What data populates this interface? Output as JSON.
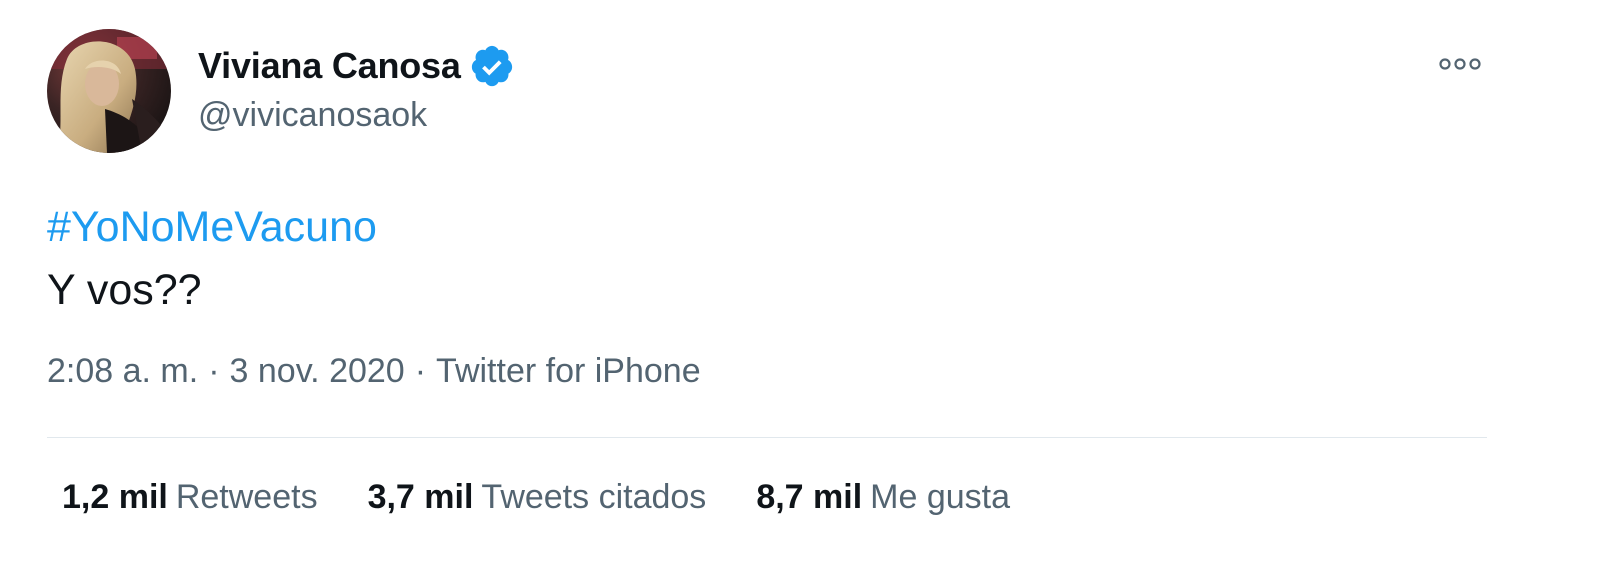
{
  "tweet": {
    "author": {
      "name": "Viviana Canosa",
      "handle": "@vivicanosaok",
      "verified": true
    },
    "text": {
      "hashtag": "#YoNoMeVacuno",
      "line2": "Y vos??"
    },
    "meta": {
      "time": "2:08 a. m.",
      "separator": "·",
      "date": "3 nov. 2020",
      "source": "Twitter for iPhone"
    },
    "stats": [
      {
        "value": "1,2 mil",
        "label": "Retweets"
      },
      {
        "value": "3,7 mil",
        "label": "Tweets citados"
      },
      {
        "value": "8,7 mil",
        "label": "Me gusta"
      }
    ]
  },
  "colors": {
    "accent": "#1d9bf0",
    "text": "#0f1419",
    "secondary": "#536471",
    "divider": "#e1e8ed"
  },
  "icons": {
    "verified": "verified-badge-icon",
    "more": "more-options-icon"
  }
}
